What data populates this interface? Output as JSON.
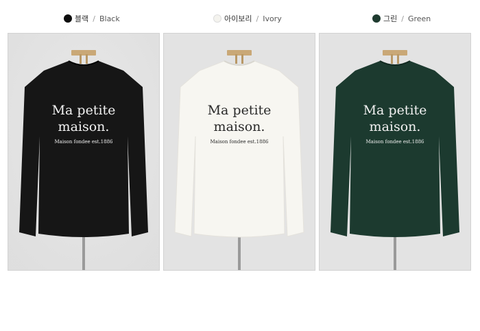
{
  "swatches": [
    {
      "korean": "블랙",
      "separator": "/",
      "english": "Black",
      "color": "#0d0d0d"
    },
    {
      "korean": "아이보리",
      "separator": "/",
      "english": "Ivory",
      "color": "#f4f3ee"
    },
    {
      "korean": "그린",
      "separator": "/",
      "english": "Green",
      "color": "#1f3b30"
    }
  ],
  "products": [
    {
      "shirt_color": "#161616",
      "print_color": "#f2f2f2",
      "print_line1": "Ma petite",
      "print_line2": "maison.",
      "print_line3": "Maison fondee est.1886"
    },
    {
      "shirt_color": "#f7f6f1",
      "print_color": "#2a2a2a",
      "print_line1": "Ma petite",
      "print_line2": "maison.",
      "print_line3": "Maison fondee est.1886"
    },
    {
      "shirt_color": "#1c3a2f",
      "print_color": "#f0f0f0",
      "print_line1": "Ma petite",
      "print_line2": "maison.",
      "print_line3": "Maison fondee est.1886"
    }
  ],
  "colors": {
    "panel_bg": "#e3e3e3",
    "hanger": "#c9a877",
    "stand": "#9a9a9a"
  },
  "icons": [
    "color-swatch-dot",
    "mannequin-stand"
  ]
}
